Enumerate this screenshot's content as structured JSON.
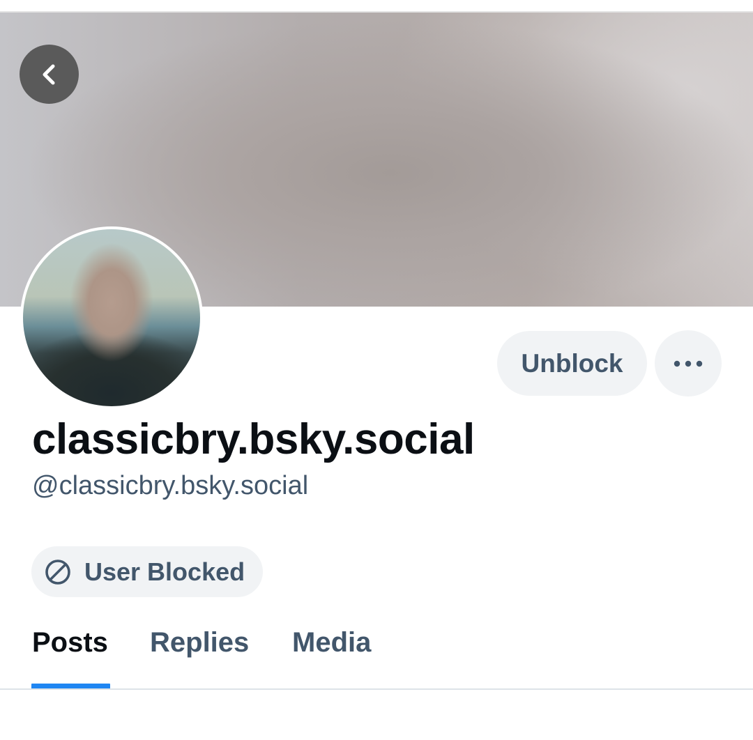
{
  "banner": {
    "back_button_icon": "chevron-left-icon"
  },
  "profile": {
    "display_name": "classicbry.bsky.social",
    "handle": "@classicbry.bsky.social",
    "avatar": "avatar-image"
  },
  "actions": {
    "unblock_label": "Unblock",
    "more_icon": "ellipsis-icon"
  },
  "status": {
    "blocked_label": "User Blocked",
    "blocked_icon": "block-icon"
  },
  "tabs": [
    {
      "label": "Posts",
      "active": true
    },
    {
      "label": "Replies",
      "active": false
    },
    {
      "label": "Media",
      "active": false
    }
  ],
  "colors": {
    "accent": "#1f86f2",
    "muted_text": "#42566b",
    "primary_text": "#0b0f14",
    "pill_background": "#f1f3f5"
  }
}
